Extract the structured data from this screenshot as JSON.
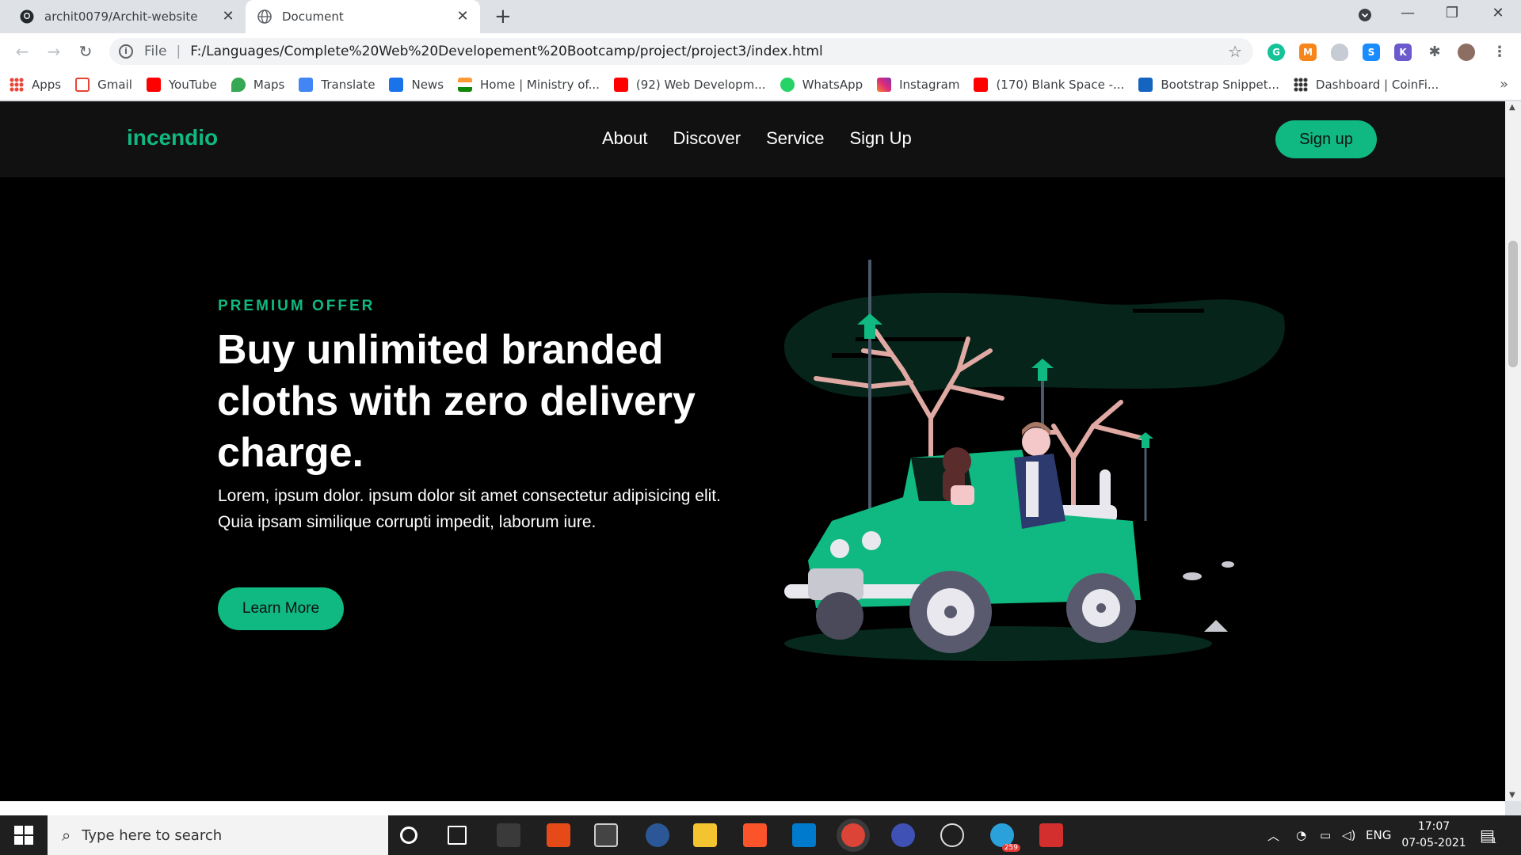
{
  "browser": {
    "tabs": [
      {
        "title": "archit0079/Archit-website",
        "icon": "github-icon"
      },
      {
        "title": "Document",
        "icon": "globe-icon"
      }
    ],
    "new_tab": "+",
    "url_scheme": "File",
    "url": "F:/Languages/Complete%20Web%20Developement%20Bootcamp/project/project3/index.html"
  },
  "bookmarks": [
    {
      "label": "Apps",
      "icon": "apps-grid-icon",
      "color": "#ea4335"
    },
    {
      "label": "Gmail",
      "icon": "gmail-icon",
      "color": "#ea4335"
    },
    {
      "label": "YouTube",
      "icon": "youtube-icon",
      "color": "#ff0000"
    },
    {
      "label": "Maps",
      "icon": "maps-icon",
      "color": "#34a853"
    },
    {
      "label": "Translate",
      "icon": "translate-icon",
      "color": "#4285f4"
    },
    {
      "label": "News",
      "icon": "news-icon",
      "color": "#1a73e8"
    },
    {
      "label": "Home | Ministry of...",
      "icon": "india-flag-icon",
      "color": "#ff9933"
    },
    {
      "label": "(92) Web Developm...",
      "icon": "youtube-icon",
      "color": "#ff0000"
    },
    {
      "label": "WhatsApp",
      "icon": "whatsapp-icon",
      "color": "#25d366"
    },
    {
      "label": "Instagram",
      "icon": "instagram-icon",
      "color": "#c13584"
    },
    {
      "label": "(170) Blank Space -...",
      "icon": "youtube-icon",
      "color": "#ff0000"
    },
    {
      "label": "Bootstrap Snippet...",
      "icon": "bootstrap-icon",
      "color": "#1565c0"
    },
    {
      "label": "Dashboard | CoinFi...",
      "icon": "coinfi-icon",
      "color": "#333333"
    }
  ],
  "site": {
    "brand": "incendio",
    "nav": [
      "About",
      "Discover",
      "Service",
      "Sign Up"
    ],
    "signup_button": "Sign up",
    "accent": "#10b981",
    "hero": {
      "eyebrow": "PREMIUM OFFER",
      "title": "Buy unlimited branded cloths with zero delivery charge.",
      "text": "Lorem, ipsum dolor. ipsum dolor sit amet consectetur adipisicing elit. Quia ipsam similique corrupti impedit, laborum iure.",
      "button": "Learn More"
    }
  },
  "taskbar": {
    "search_placeholder": "Type here to search",
    "language": "ENG",
    "time": "17:07",
    "date": "07-05-2021",
    "notification_count": "1",
    "telegram_badge": "259"
  }
}
